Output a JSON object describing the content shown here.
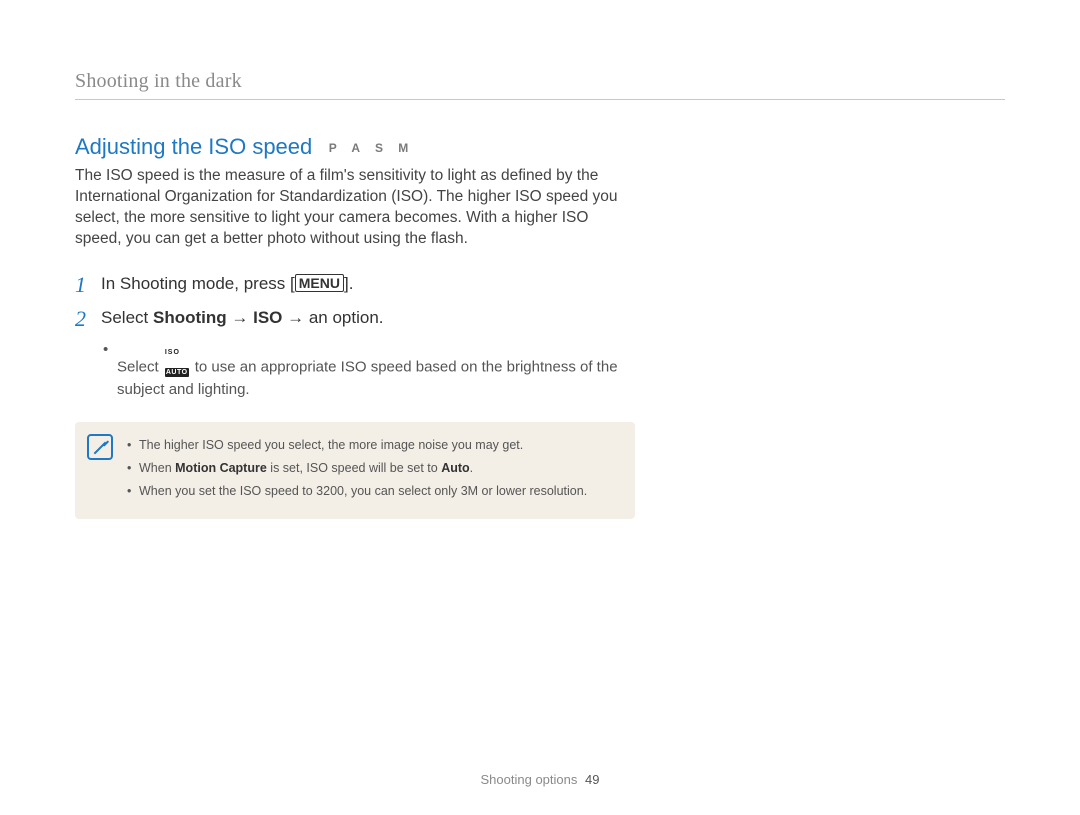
{
  "breadcrumb": "Shooting in the dark",
  "heading": "Adjusting the ISO speed",
  "modes": "P A S M",
  "intro": "The ISO speed is the measure of a film's sensitivity to light as defined by the International Organization for Standardization (ISO). The higher ISO speed you select, the more sensitive to light your camera becomes. With a higher ISO speed, you can get a better photo without using the flash.",
  "steps": {
    "s1": {
      "num": "1",
      "pre": "In Shooting mode, press [",
      "menu": "MENU",
      "post": "]."
    },
    "s2": {
      "num": "2",
      "select_word": "Select ",
      "b1": "Shooting",
      "arr1": " → ",
      "b2": "ISO",
      "arr2": " → ",
      "tail": "an option.",
      "bullet_pre": "Select ",
      "bullet_post": " to use an appropriate ISO speed based on the brightness of the subject and lighting."
    }
  },
  "iso_auto_icon": {
    "top": "ISO",
    "bot": "AUTO"
  },
  "notes": {
    "n1": "The higher ISO speed you select, the more image noise you may get.",
    "n2_pre": "When ",
    "n2_b1": "Motion Capture",
    "n2_mid": " is set, ISO speed will be set to ",
    "n2_b2": "Auto",
    "n2_post": ".",
    "n3": "When you set the ISO speed to 3200, you can select only 3M or lower resolution."
  },
  "footer": {
    "section": "Shooting options",
    "page": "49"
  }
}
